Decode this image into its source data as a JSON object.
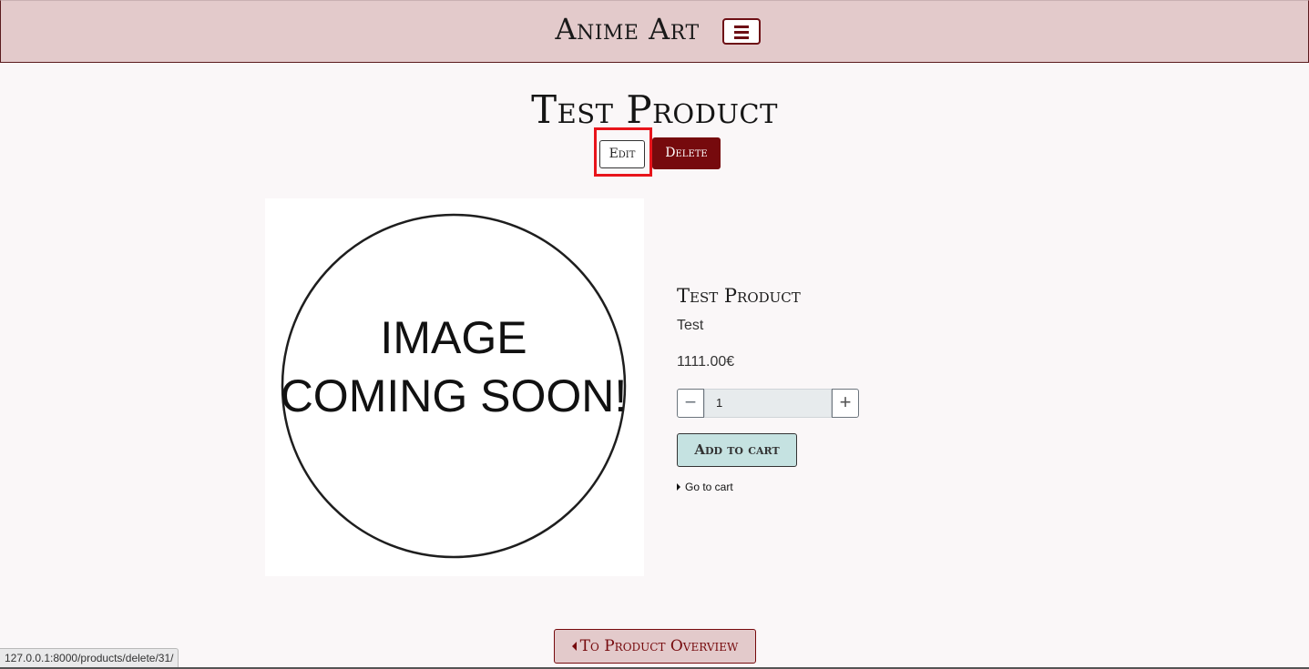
{
  "header": {
    "brand": "Anime Art",
    "menu_icon": "hamburger-icon",
    "brand_color": "#e3cacb"
  },
  "page": {
    "title": "Test Product",
    "edit_label": "Edit",
    "delete_label": "Delete"
  },
  "product": {
    "image_text_line1": "IMAGE",
    "image_text_line2": "COMING SOON!",
    "name": "Test Product",
    "description": "Test",
    "price": "1111.00€",
    "quantity": "1",
    "add_to_cart_label": "Add to cart",
    "go_to_cart_label": "Go to cart"
  },
  "footer": {
    "overview_label": "To Product Overview"
  },
  "status_bar": {
    "url": "127.0.0.1:8000/products/delete/31/"
  },
  "colors": {
    "accent": "#760a0d",
    "cart_button": "#c5e2e1",
    "highlight": "#e8141b"
  }
}
